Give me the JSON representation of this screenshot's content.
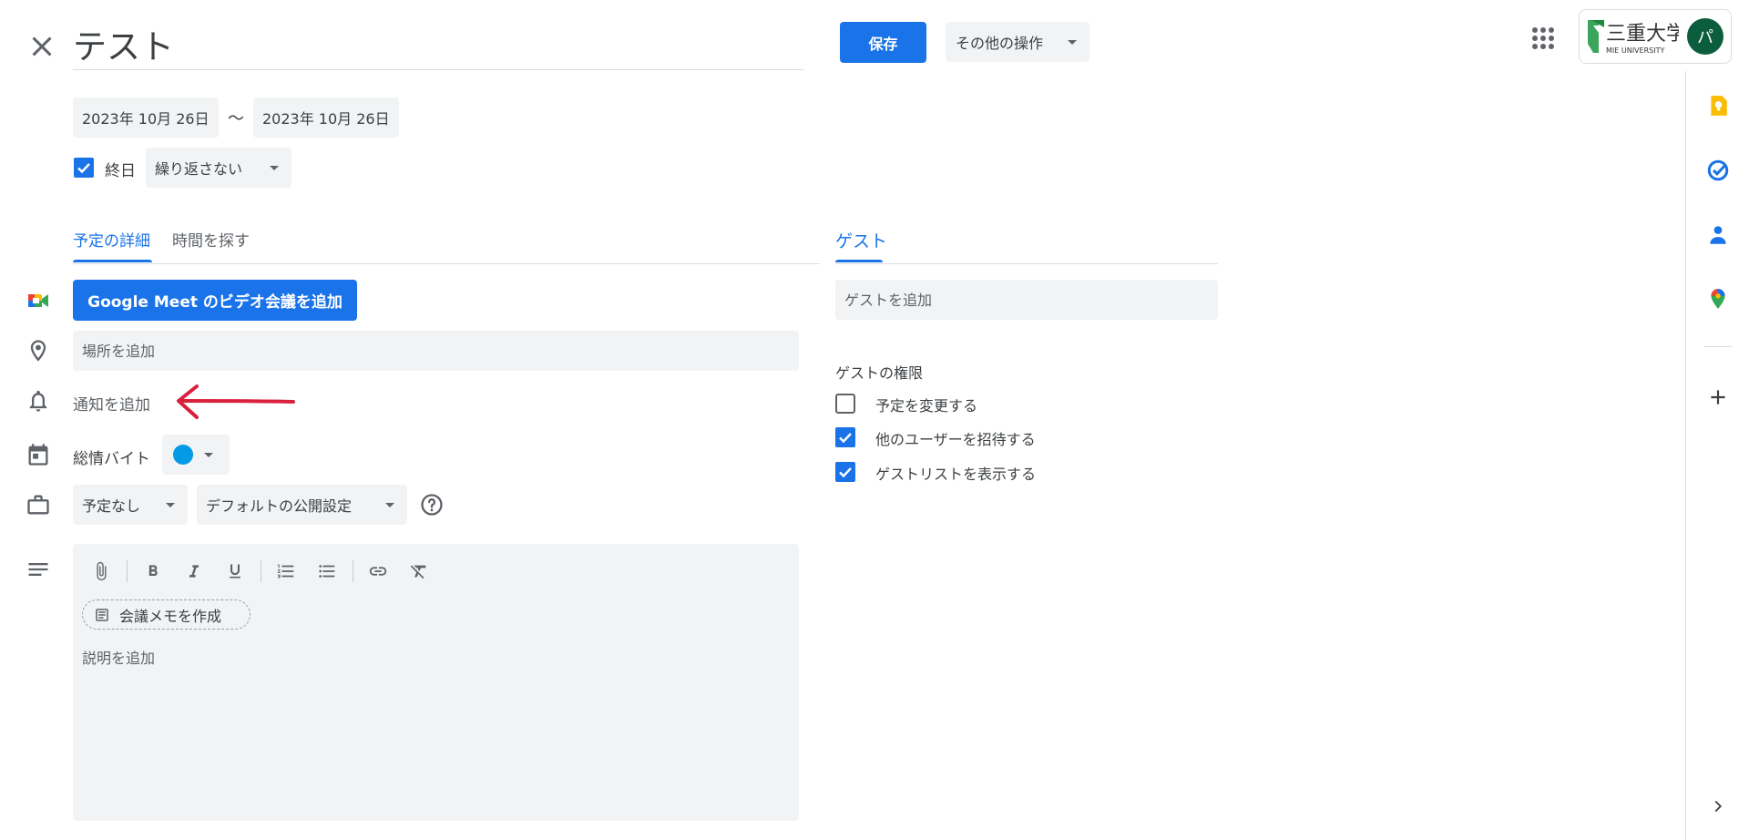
{
  "header": {
    "title": "テスト",
    "save_label": "保存",
    "more_actions_label": "その他の操作",
    "account": {
      "avatar_initial": "パ"
    }
  },
  "dates": {
    "start": "2023年 10月 26日",
    "separator": "〜",
    "end": "2023年 10月 26日",
    "all_day_label": "終日",
    "all_day_checked": true,
    "repeat": "繰り返さない"
  },
  "tabs": {
    "details": "予定の詳細",
    "find_time": "時間を探す"
  },
  "details": {
    "meet_button": "Google Meet のビデオ会議を追加",
    "location_placeholder": "場所を追加",
    "notification_link": "通知を追加",
    "calendar_name": "総情バイト",
    "calendar_color": "#039be5",
    "availability": "予定なし",
    "visibility": "デフォルトの公開設定",
    "notes_button": "会議メモを作成",
    "description_placeholder": "説明を追加"
  },
  "guests": {
    "tab_label": "ゲスト",
    "input_placeholder": "ゲストを追加",
    "permissions_title": "ゲストの権限",
    "permissions": [
      {
        "label": "予定を変更する",
        "checked": false
      },
      {
        "label": "他のユーザーを招待する",
        "checked": true
      },
      {
        "label": "ゲストリストを表示する",
        "checked": true
      }
    ]
  },
  "colors": {
    "accent": "#1a73e8",
    "annotation_arrow": "#d9213d"
  }
}
